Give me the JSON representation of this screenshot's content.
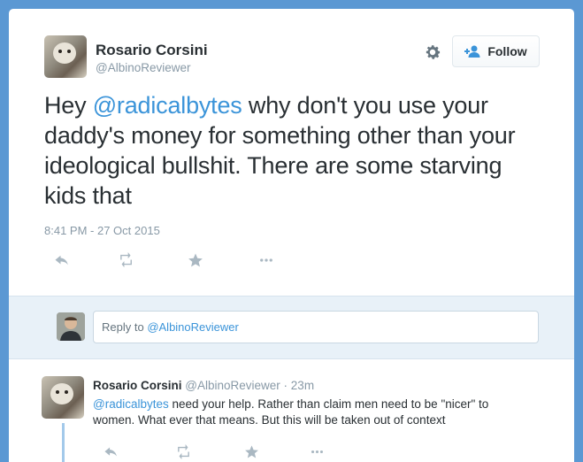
{
  "tweet": {
    "author_name": "Rosario Corsini",
    "author_handle": "@AlbinoReviewer",
    "text_before": "Hey ",
    "mention": "@radicalbytes",
    "text_after": " why don't you use your daddy's money for something other than your ideological bullshit. There are some starving kids that",
    "timestamp": "8:41 PM - 27 Oct 2015",
    "follow_label": "Follow"
  },
  "reply_box": {
    "prefix": "Reply to ",
    "mention": "@AlbinoReviewer"
  },
  "reply": {
    "author_name": "Rosario Corsini",
    "author_handle": "@AlbinoReviewer",
    "separator": " · ",
    "time": "23m",
    "mention": "@radicalbytes",
    "text_after": " need your help. Rather than claim men need to be \"nicer\" to women. What ever that means. But this will be taken out of context"
  },
  "colors": {
    "background": "#5b98d3",
    "link": "#3b94d9",
    "muted": "#8899a6",
    "text": "#292f33"
  },
  "icons": [
    "gear-icon",
    "follow-person-icon",
    "reply-icon",
    "retweet-icon",
    "favorite-star-icon",
    "more-dots-icon"
  ]
}
